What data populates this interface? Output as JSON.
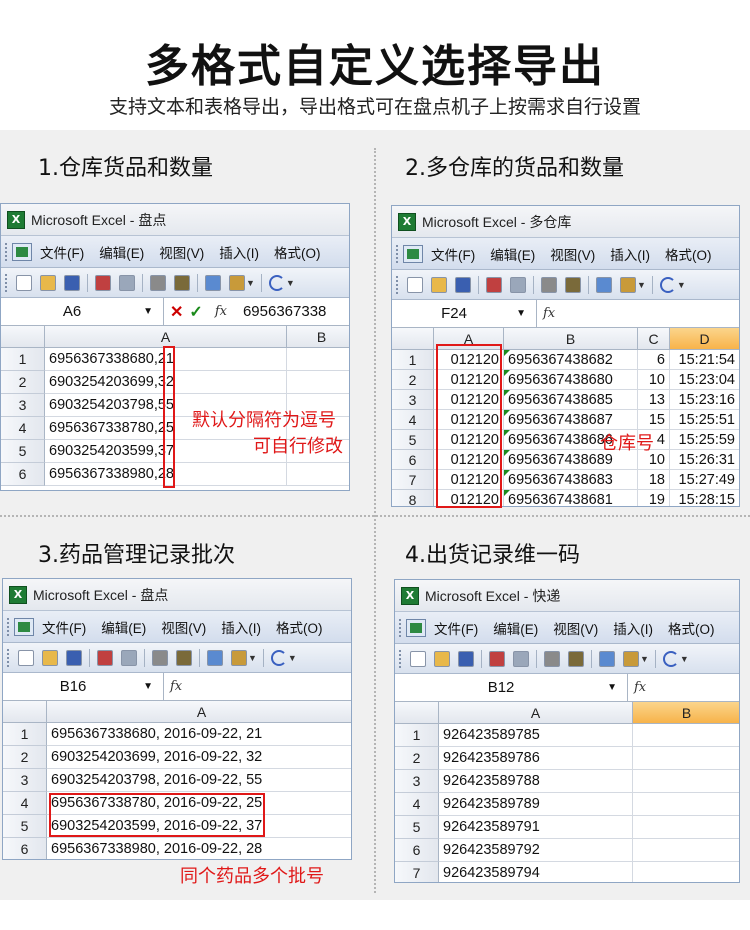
{
  "header": {
    "title": "多格式自定义选择导出",
    "subtitle": "支持文本和表格导出，导出格式可在盘点机子上按需求自行设置"
  },
  "colors": {
    "accent_red": "#e01818",
    "excel_green": "#1e7b34",
    "menu_blue": "#d3dded",
    "selected_col": "#f7b34a"
  },
  "menu": [
    "文件(F)",
    "编辑(E)",
    "视图(V)",
    "插入(I)",
    "格式(O)"
  ],
  "toolbar_icons": [
    "new-icon",
    "open-icon",
    "save-icon",
    "permission-icon",
    "print-icon",
    "print-preview-icon",
    "research-icon",
    "copy-icon",
    "paste-icon",
    "undo-icon"
  ],
  "fx_symbol": "fx",
  "panel1": {
    "section": "1.仓库货品和数量",
    "window_title": "Microsoft Excel - 盘点",
    "namebox": "A6",
    "formula": "6956367338",
    "columns": [
      "A",
      "B"
    ],
    "rows": [
      {
        "n": "1",
        "a": "6956367338680,21"
      },
      {
        "n": "2",
        "a": "6903254203699,32"
      },
      {
        "n": "3",
        "a": "6903254203798,55"
      },
      {
        "n": "4",
        "a": "6956367338780,25"
      },
      {
        "n": "5",
        "a": "6903254203599,37"
      },
      {
        "n": "6",
        "a": "6956367338980,28"
      }
    ],
    "annotation_line1": "默认分隔符为逗号",
    "annotation_line2": "可自行修改"
  },
  "panel2": {
    "section": "2.多仓库的货品和数量",
    "window_title": "Microsoft Excel - 多仓库",
    "namebox": "F24",
    "columns": [
      "A",
      "B",
      "C",
      "D"
    ],
    "rows": [
      {
        "n": "1",
        "a": "012120",
        "b": "6956367438682",
        "c": "6",
        "d": "15:21:54"
      },
      {
        "n": "2",
        "a": "012120",
        "b": "6956367438680",
        "c": "10",
        "d": "15:23:04"
      },
      {
        "n": "3",
        "a": "012120",
        "b": "6956367438685",
        "c": "13",
        "d": "15:23:16"
      },
      {
        "n": "4",
        "a": "012120",
        "b": "6956367438687",
        "c": "15",
        "d": "15:25:51"
      },
      {
        "n": "5",
        "a": "012120",
        "b": "6956367438686",
        "c": "4",
        "d": "15:25:59"
      },
      {
        "n": "6",
        "a": "012120",
        "b": "6956367438689",
        "c": "10",
        "d": "15:26:31"
      },
      {
        "n": "7",
        "a": "012120",
        "b": "6956367438683",
        "c": "18",
        "d": "15:27:49"
      },
      {
        "n": "8",
        "a": "012120",
        "b": "6956367438681",
        "c": "19",
        "d": "15:28:15"
      }
    ],
    "annotation": "仓库号"
  },
  "panel3": {
    "section": "3.药品管理记录批次",
    "window_title": "Microsoft Excel - 盘点",
    "namebox": "B16",
    "columns": [
      "A"
    ],
    "rows": [
      {
        "n": "1",
        "a": "6956367338680, 2016-09-22, 21"
      },
      {
        "n": "2",
        "a": "6903254203699, 2016-09-22, 32"
      },
      {
        "n": "3",
        "a": "6903254203798, 2016-09-22, 55"
      },
      {
        "n": "4",
        "a": "6956367338780, 2016-09-22, 25"
      },
      {
        "n": "5",
        "a": "6903254203599, 2016-09-22, 37"
      },
      {
        "n": "6",
        "a": "6956367338980, 2016-09-22, 28"
      }
    ],
    "annotation": "同个药品多个批号"
  },
  "panel4": {
    "section": "4.出货记录维一码",
    "window_title": "Microsoft Excel - 快递",
    "namebox": "B12",
    "columns": [
      "A",
      "B"
    ],
    "rows": [
      {
        "n": "1",
        "a": "926423589785"
      },
      {
        "n": "2",
        "a": "926423589786"
      },
      {
        "n": "3",
        "a": "926423589788"
      },
      {
        "n": "4",
        "a": "926423589789"
      },
      {
        "n": "5",
        "a": "926423589791"
      },
      {
        "n": "6",
        "a": "926423589792"
      },
      {
        "n": "7",
        "a": "926423589794"
      }
    ]
  }
}
